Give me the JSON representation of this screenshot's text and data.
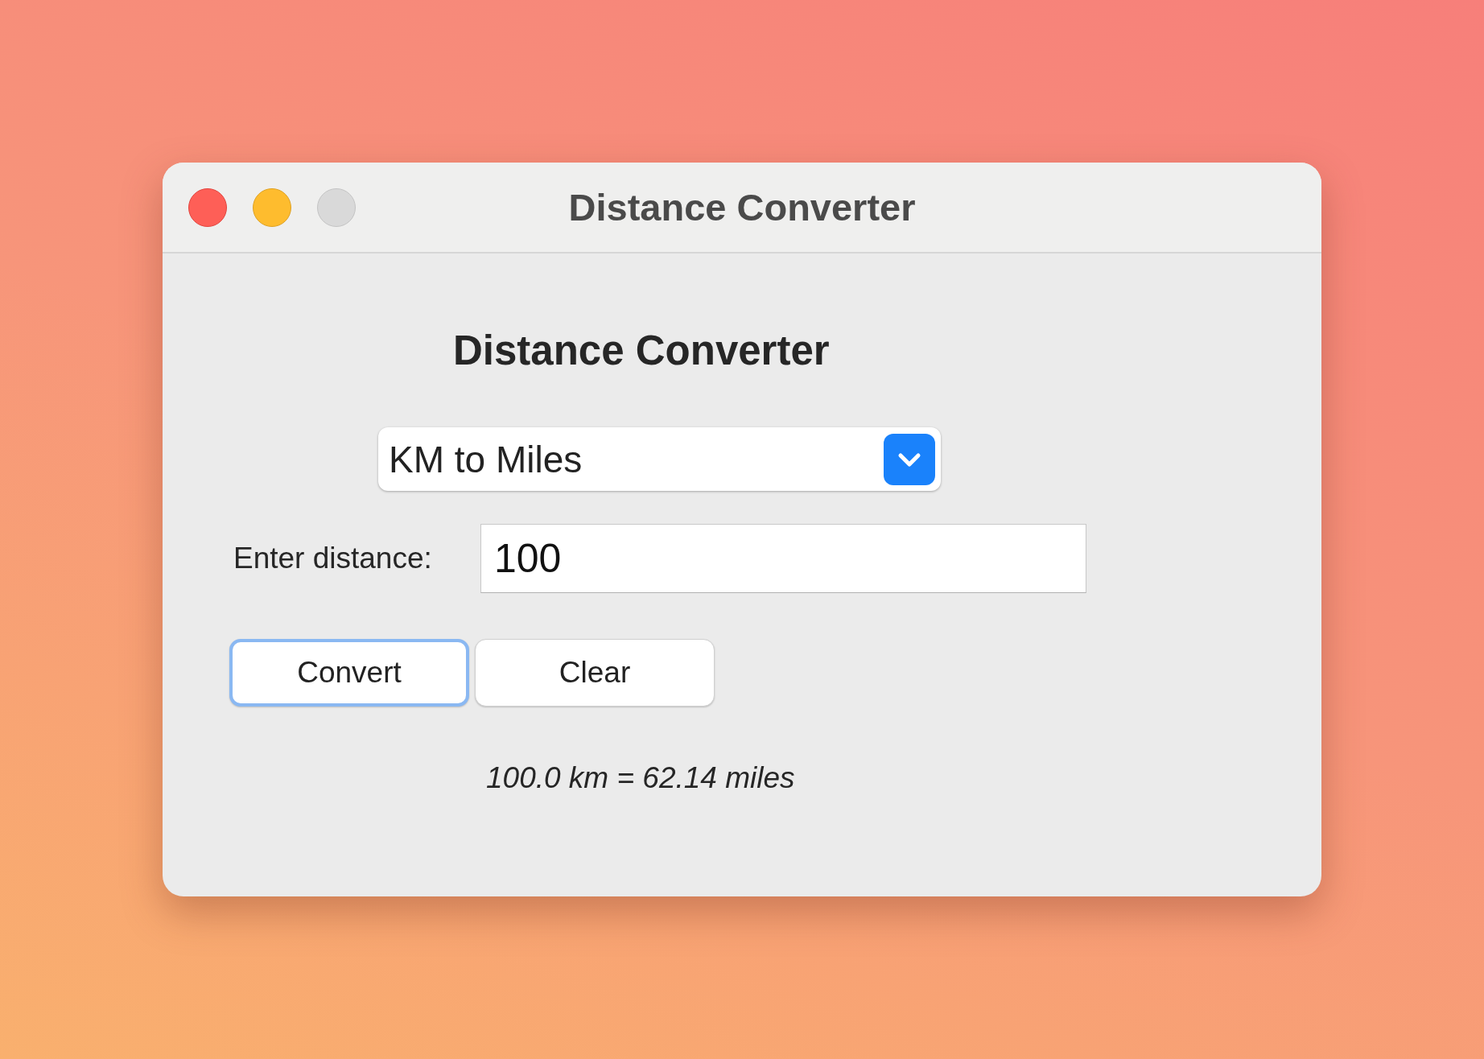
{
  "window": {
    "title": "Distance Converter"
  },
  "heading": "Distance Converter",
  "dropdown": {
    "value": "KM to Miles"
  },
  "distance": {
    "label": "Enter distance:",
    "value": "100"
  },
  "buttons": [
    {
      "label": "Convert",
      "focused": true
    },
    {
      "label": "Clear",
      "focused": false
    }
  ],
  "result": "100.0 km = 62.14 miles"
}
